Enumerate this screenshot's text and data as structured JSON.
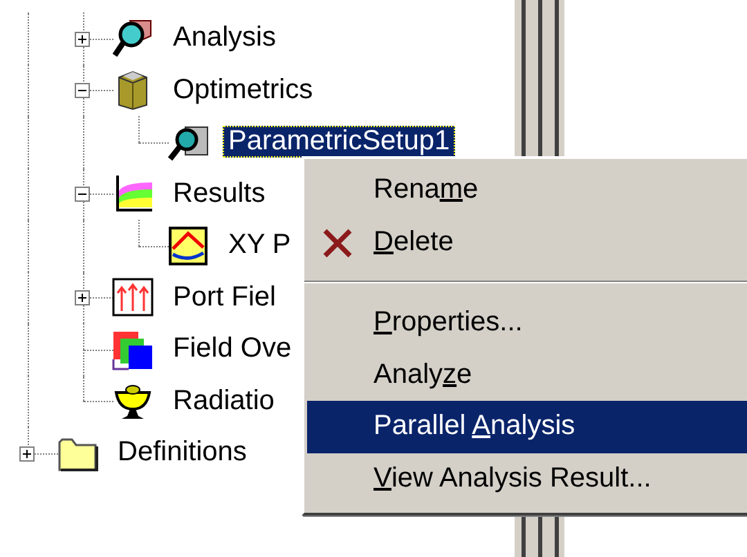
{
  "tree": {
    "continued_items": [
      {
        "label": "Analysis",
        "kind": "analysis",
        "expanded": false,
        "selected": false
      },
      {
        "label": "Optimetrics",
        "kind": "optimetrics",
        "expanded": true,
        "selected": false,
        "children": [
          {
            "label": "ParametricSetup1",
            "kind": "setup",
            "selected": true
          }
        ]
      },
      {
        "label": "Results",
        "kind": "results",
        "expanded": true,
        "selected": false,
        "children": [
          {
            "label": "XY P",
            "kind": "plot",
            "selected": false
          }
        ]
      },
      {
        "label": "Port Fiel",
        "kind": "port-fields",
        "expanded": false,
        "selected": false
      },
      {
        "label": "Field Ove",
        "kind": "field-overlays",
        "selected": false
      },
      {
        "label": "Radiatio",
        "kind": "radiation",
        "selected": false
      }
    ],
    "items": [
      {
        "label": "Definitions",
        "kind": "folder",
        "expanded": false,
        "selected": false
      }
    ]
  },
  "context_menu": {
    "items": [
      {
        "kind": "item",
        "label": {
          "before": "Rena",
          "access_key": "m",
          "after": "e"
        },
        "selected": false
      },
      {
        "kind": "cross_item",
        "label": {
          "access_key": "D",
          "after": "elete"
        },
        "selected": false
      },
      {
        "kind": "separator"
      },
      {
        "kind": "item",
        "label": {
          "access_key": "P",
          "after": "roperties..."
        },
        "selected": false
      },
      {
        "kind": "item",
        "label": {
          "before": "Analy",
          "access_key": "z",
          "after": "e"
        },
        "selected": false
      },
      {
        "kind": "item",
        "label": {
          "before": "Parallel ",
          "access_key": "A",
          "after": "nalysis"
        },
        "selected": true
      },
      {
        "kind": "item",
        "label": {
          "access_key": "V",
          "after": "iew Analysis Result..."
        },
        "selected": false
      }
    ]
  }
}
